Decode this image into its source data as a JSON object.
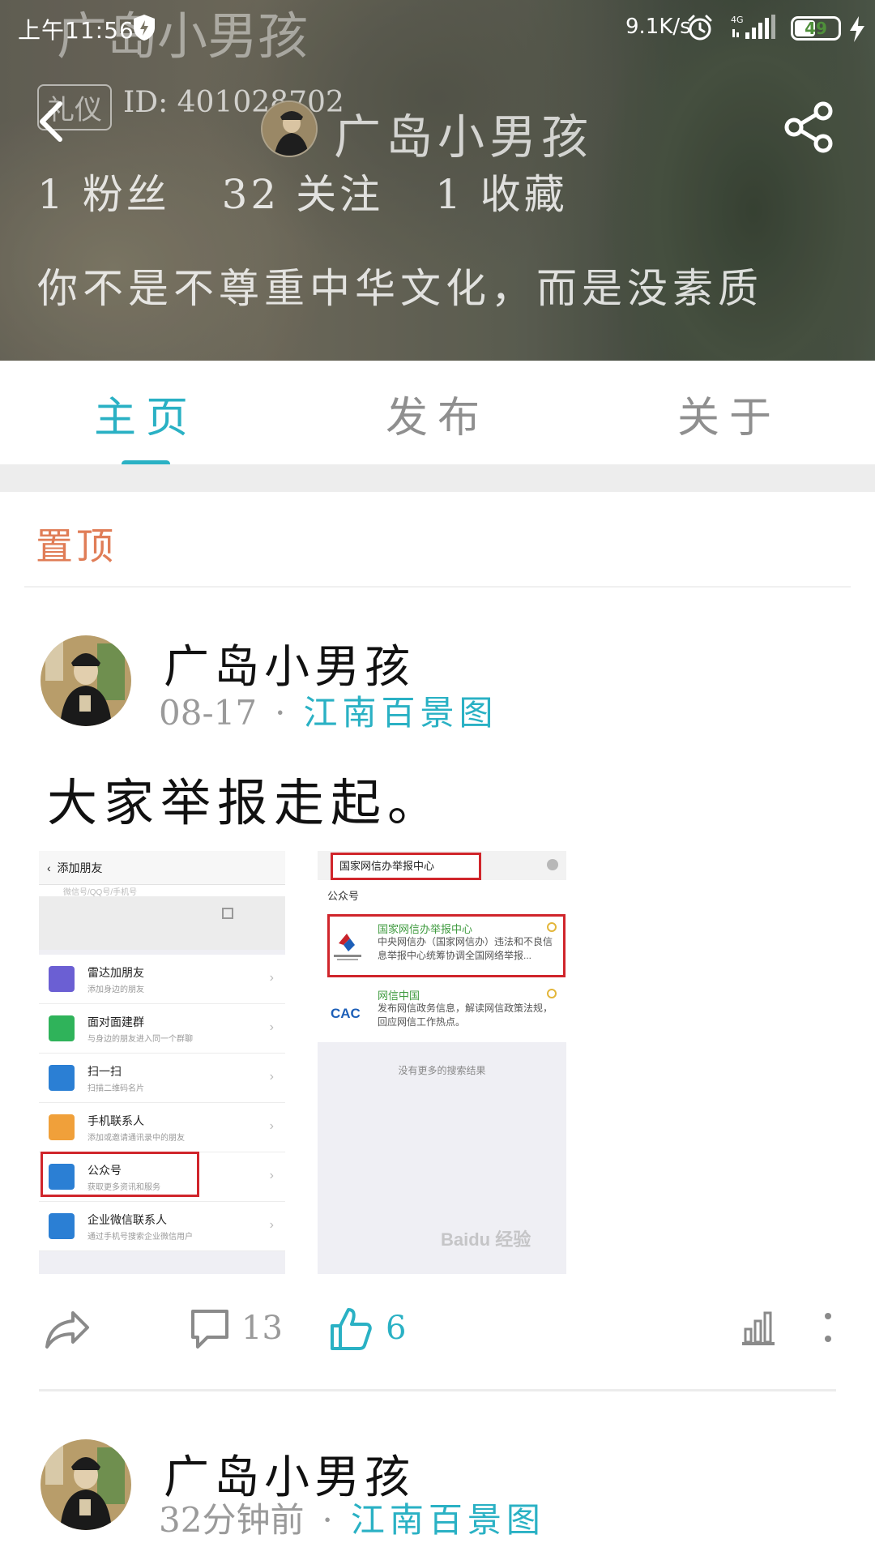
{
  "status_bar": {
    "time": "上午11:56",
    "net_speed": "9.1K/s",
    "battery": "49",
    "battery_fraction": 0.49,
    "network": "4G"
  },
  "profile": {
    "ghost_title": "广岛小男孩",
    "badge": "礼仪",
    "user_id": "ID: 401028702",
    "name": "广岛小男孩",
    "stats": {
      "fans": "1 粉丝",
      "following": "32 关注",
      "favorites": "1 收藏"
    },
    "signature": "你不是不尊重中华文化，而是没素质"
  },
  "tabs": [
    {
      "label": "主页",
      "active": true
    },
    {
      "label": "发布",
      "active": false
    },
    {
      "label": "关于",
      "active": false
    }
  ],
  "pinned_label": "置顶",
  "posts": [
    {
      "author": "广岛小男孩",
      "date": "08-17",
      "circle": "江南百景图",
      "text": "大家举报走起。",
      "images": {
        "left": {
          "title": "添加朋友",
          "search_placeholder": "微信号/QQ号/手机号",
          "items": [
            {
              "title": "雷达加朋友",
              "sub": "添加身边的朋友",
              "color": "#6b5fd3"
            },
            {
              "title": "面对面建群",
              "sub": "与身边的朋友进入同一个群聊",
              "color": "#2fb35a"
            },
            {
              "title": "扫一扫",
              "sub": "扫描二维码名片",
              "color": "#2b7fd4"
            },
            {
              "title": "手机联系人",
              "sub": "添加或邀请通讯录中的朋友",
              "color": "#f0a03a"
            },
            {
              "title": "公众号",
              "sub": "获取更多资讯和服务",
              "color": "#2b7fd4"
            },
            {
              "title": "企业微信联系人",
              "sub": "通过手机号搜索企业微信用户",
              "color": "#2b7fd4"
            }
          ]
        },
        "right": {
          "search_value": "国家网信办举报中心",
          "section_label": "公众号",
          "result1_name": "国家网信办举报中心",
          "result1_desc": "中央网信办（国家网信办）违法和不良信息举报中心统筹协调全国网络举报...",
          "result2_name": "网信中国",
          "result2_desc": "发布网信政务信息，解读网信政策法规，回应网信工作热点。",
          "logo2_text": "CAC",
          "no_more": "没有更多的搜索结果",
          "watermark": "Baidu 经验"
        }
      },
      "comments": "13",
      "likes": "6"
    },
    {
      "author": "广岛小男孩",
      "date": "32分钟前",
      "circle": "江南百景图"
    }
  ],
  "colors": {
    "accent": "#2ab1c4",
    "pinned": "#e07d57",
    "highlight_box": "#d0252b"
  }
}
